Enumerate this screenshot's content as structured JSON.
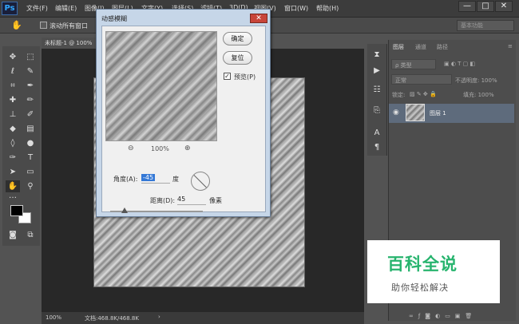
{
  "app": {
    "logo": "Ps"
  },
  "menus": [
    "文件(F)",
    "编辑(E)",
    "图像(I)",
    "图层(L)",
    "文字(Y)",
    "选择(S)",
    "滤镜(T)",
    "3D(D)",
    "视图(V)",
    "窗口(W)",
    "帮助(H)"
  ],
  "window_controls": {
    "min": "—",
    "max": "□",
    "close": "✕"
  },
  "options": {
    "scroll_all_label": "滚动所有窗口",
    "workspace": "基本功能"
  },
  "document": {
    "tab_label": "未标题-1 @ 100%",
    "zoom": "100%",
    "status": "文档:468.8K/468.8K"
  },
  "dialog": {
    "title": "动感模糊",
    "ok": "确定",
    "reset": "复位",
    "preview_label": "预览(P)",
    "preview_checked": true,
    "zoom": "100%",
    "angle_label": "角度(A):",
    "angle_value": "-45",
    "angle_unit": "度",
    "distance_label": "距离(D):",
    "distance_value": "45",
    "distance_unit": "像素",
    "distance_level": 0.09
  },
  "panels": {
    "tabs": [
      "图层",
      "通道",
      "路径"
    ],
    "kind_label": "ρ 类型",
    "blend_mode": "正常",
    "opacity_label": "不透明度: 100%",
    "lock_label": "锁定:",
    "fill_label": "填充: 100%",
    "layer_name": "图层 1"
  },
  "watermark": {
    "title": "百科全说",
    "subtitle": "助你轻松解决"
  }
}
